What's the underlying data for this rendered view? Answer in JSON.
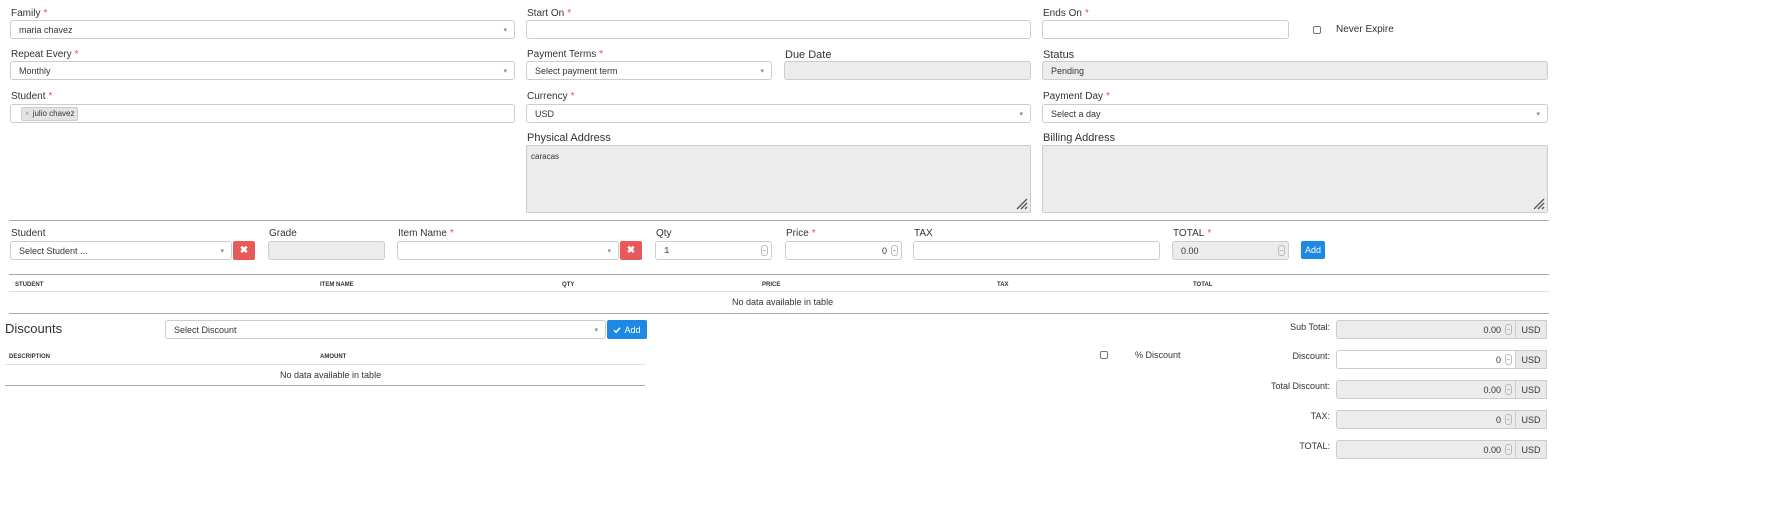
{
  "form": {
    "family": {
      "label": "Family",
      "value": "maria chavez"
    },
    "start_on": {
      "label": "Start On",
      "value": ""
    },
    "ends_on": {
      "label": "Ends On",
      "value": ""
    },
    "never_expire": {
      "label": "Never Expire",
      "checked": false
    },
    "repeat_every": {
      "label": "Repeat Every",
      "value": "Monthly"
    },
    "payment_terms": {
      "label": "Payment Terms",
      "value": "Select payment term"
    },
    "due_date": {
      "label": "Due Date",
      "value": ""
    },
    "status": {
      "label": "Status",
      "value": "Pending"
    },
    "student": {
      "label": "Student",
      "tag": "julio chavez",
      "tag_remove": "×"
    },
    "currency": {
      "label": "Currency",
      "value": "USD"
    },
    "payment_day": {
      "label": "Payment Day",
      "value": "Select a day"
    },
    "physical_address": {
      "label": "Physical Address",
      "value": "caracas"
    },
    "billing_address": {
      "label": "Billing Address",
      "value": ""
    }
  },
  "item_entry": {
    "student": {
      "label": "Student",
      "value": "Select Student ..."
    },
    "grade": {
      "label": "Grade",
      "value": ""
    },
    "item_name": {
      "label": "Item Name",
      "value": ""
    },
    "qty": {
      "label": "Qty",
      "value": "1"
    },
    "price": {
      "label": "Price",
      "value": "0"
    },
    "tax": {
      "label": "TAX",
      "value": ""
    },
    "total": {
      "label": "TOTAL",
      "value": "0.00"
    },
    "add_label": "Add",
    "clear_glyph": "✖"
  },
  "items_table": {
    "columns": [
      "STUDENT",
      "ITEM NAME",
      "QTY",
      "PRICE",
      "TAX",
      "TOTAL"
    ],
    "empty": "No data available in table"
  },
  "discounts": {
    "title": "Discounts",
    "select_value": "Select Discount",
    "add_label": "Add",
    "columns": [
      "DESCRIPTION",
      "AMOUNT"
    ],
    "empty": "No data available in table",
    "percent_label": "% Discount",
    "percent_checked": false
  },
  "totals": {
    "currency": "USD",
    "sub_total": {
      "label": "Sub Total:",
      "value": "0.00"
    },
    "discount": {
      "label": "Discount:",
      "value": "0"
    },
    "total_discount": {
      "label": "Total Discount:",
      "value": "0.00"
    },
    "tax": {
      "label": "TAX:",
      "value": "0"
    },
    "total": {
      "label": "TOTAL:",
      "value": "0.00"
    }
  },
  "colors": {
    "required": "#d9534f",
    "primary": "#1e88e5",
    "danger": "#e85a5a",
    "readonly": "#ececec"
  },
  "icons": {
    "check": "check-icon",
    "clear": "times-icon",
    "dropdown": "chevron-down-icon",
    "resize": "resize-grip-icon"
  }
}
